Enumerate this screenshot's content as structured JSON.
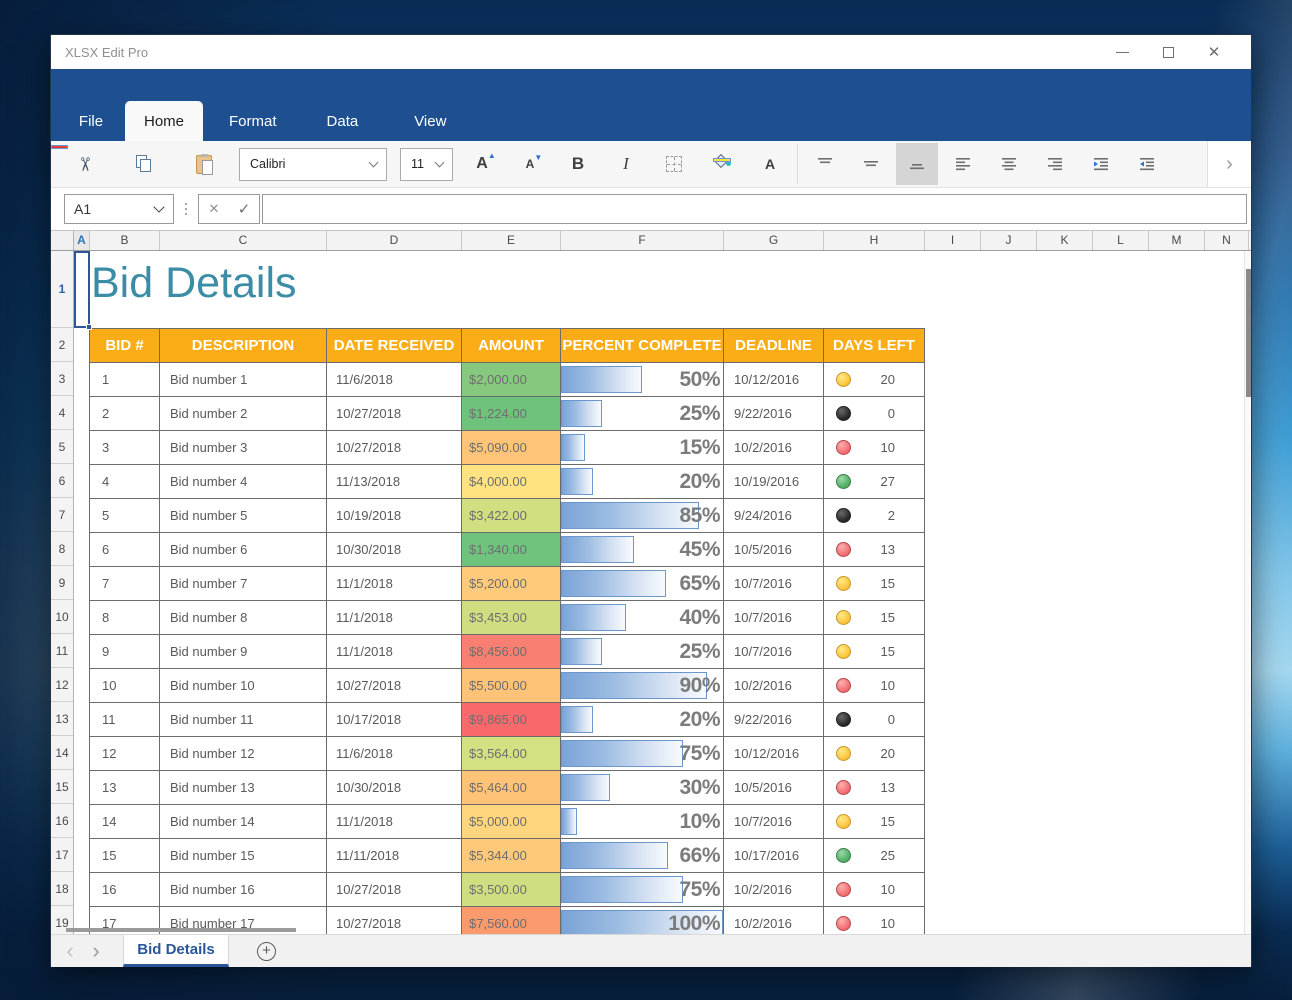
{
  "window": {
    "title": "XLSX Edit Pro"
  },
  "ribbon": {
    "tabs": [
      "File",
      "Home",
      "Format",
      "Data",
      "View"
    ],
    "active_tab": "Home"
  },
  "toolbar": {
    "font_name": "Calibri",
    "font_size": "11",
    "bold_glyph": "B",
    "italic_glyph": "I",
    "grow_font_glyph": "A",
    "shrink_font_glyph": "A",
    "font_color_glyph": "A"
  },
  "glyphs": {
    "cut": "✂",
    "cancel": "✕",
    "check": "✓",
    "chevron_left": "‹",
    "chevron_right": "›",
    "overflow_chevron": "›",
    "add_sheet": "+",
    "close_window": "✕"
  },
  "formula_bar": {
    "cell_reference": "A1",
    "formula_value": ""
  },
  "grid": {
    "column_headers": [
      "A",
      "B",
      "C",
      "D",
      "E",
      "F",
      "G",
      "H",
      "I",
      "J",
      "K",
      "L",
      "M",
      "N"
    ],
    "row_headers": [
      "1",
      "2",
      "3",
      "4",
      "5",
      "6",
      "7",
      "8",
      "9",
      "10",
      "11",
      "12",
      "13",
      "14",
      "15",
      "16",
      "17",
      "18",
      "19"
    ],
    "selected_cell": "A1",
    "selected_column": "A",
    "selected_row": "1",
    "sheet_title": "Bid Details"
  },
  "table": {
    "headers": [
      "BID #",
      "DESCRIPTION",
      "DATE RECEIVED",
      "AMOUNT",
      "PERCENT COMPLETE",
      "DEADLINE",
      "DAYS LEFT"
    ],
    "rows": [
      {
        "bid": "1",
        "description": "Bid number 1",
        "date_received": "11/6/2018",
        "amount": "$2,000.00",
        "amount_color": "#86C87E",
        "percent_value": 50,
        "percent_label": "50%",
        "deadline": "10/12/2016",
        "status_light": "yellow",
        "days_left": "20"
      },
      {
        "bid": "2",
        "description": "Bid number 2",
        "date_received": "10/27/2018",
        "amount": "$1,224.00",
        "amount_color": "#6EC27C",
        "percent_value": 25,
        "percent_label": "25%",
        "deadline": "9/22/2016",
        "status_light": "black",
        "days_left": "0"
      },
      {
        "bid": "3",
        "description": "Bid number 3",
        "date_received": "10/27/2018",
        "amount": "$5,090.00",
        "amount_color": "#FFC478",
        "percent_value": 15,
        "percent_label": "15%",
        "deadline": "10/2/2016",
        "status_light": "red",
        "days_left": "10"
      },
      {
        "bid": "4",
        "description": "Bid number 4",
        "date_received": "11/13/2018",
        "amount": "$4,000.00",
        "amount_color": "#FFE383",
        "percent_value": 20,
        "percent_label": "20%",
        "deadline": "10/19/2016",
        "status_light": "green",
        "days_left": "27"
      },
      {
        "bid": "5",
        "description": "Bid number 5",
        "date_received": "10/19/2018",
        "amount": "$3,422.00",
        "amount_color": "#D2DF81",
        "percent_value": 85,
        "percent_label": "85%",
        "deadline": "9/24/2016",
        "status_light": "black",
        "days_left": "2"
      },
      {
        "bid": "6",
        "description": "Bid number 6",
        "date_received": "10/30/2018",
        "amount": "$1,340.00",
        "amount_color": "#70C37C",
        "percent_value": 45,
        "percent_label": "45%",
        "deadline": "10/5/2016",
        "status_light": "red",
        "days_left": "13"
      },
      {
        "bid": "7",
        "description": "Bid number 7",
        "date_received": "11/1/2018",
        "amount": "$5,200.00",
        "amount_color": "#FFCA7A",
        "percent_value": 65,
        "percent_label": "65%",
        "deadline": "10/7/2016",
        "status_light": "yellow",
        "days_left": "15"
      },
      {
        "bid": "8",
        "description": "Bid number 8",
        "date_received": "11/1/2018",
        "amount": "$3,453.00",
        "amount_color": "#D0DE81",
        "percent_value": 40,
        "percent_label": "40%",
        "deadline": "10/7/2016",
        "status_light": "yellow",
        "days_left": "15"
      },
      {
        "bid": "9",
        "description": "Bid number 9",
        "date_received": "11/1/2018",
        "amount": "$8,456.00",
        "amount_color": "#F87F72",
        "percent_value": 25,
        "percent_label": "25%",
        "deadline": "10/7/2016",
        "status_light": "yellow",
        "days_left": "15"
      },
      {
        "bid": "10",
        "description": "Bid number 10",
        "date_received": "10/27/2018",
        "amount": "$5,500.00",
        "amount_color": "#FFC377",
        "percent_value": 90,
        "percent_label": "90%",
        "deadline": "10/2/2016",
        "status_light": "red",
        "days_left": "10"
      },
      {
        "bid": "11",
        "description": "Bid number 11",
        "date_received": "10/17/2018",
        "amount": "$9,865.00",
        "amount_color": "#F8696B",
        "percent_value": 20,
        "percent_label": "20%",
        "deadline": "9/22/2016",
        "status_light": "black",
        "days_left": "0"
      },
      {
        "bid": "12",
        "description": "Bid number 12",
        "date_received": "11/6/2018",
        "amount": "$3,564.00",
        "amount_color": "#D4E081",
        "percent_value": 75,
        "percent_label": "75%",
        "deadline": "10/12/2016",
        "status_light": "yellow",
        "days_left": "20"
      },
      {
        "bid": "13",
        "description": "Bid number 13",
        "date_received": "10/30/2018",
        "amount": "$5,464.00",
        "amount_color": "#FFC377",
        "percent_value": 30,
        "percent_label": "30%",
        "deadline": "10/5/2016",
        "status_light": "red",
        "days_left": "13"
      },
      {
        "bid": "14",
        "description": "Bid number 14",
        "date_received": "11/1/2018",
        "amount": "$5,000.00",
        "amount_color": "#FFD67E",
        "percent_value": 10,
        "percent_label": "10%",
        "deadline": "10/7/2016",
        "status_light": "yellow",
        "days_left": "15"
      },
      {
        "bid": "15",
        "description": "Bid number 15",
        "date_received": "11/11/2018",
        "amount": "$5,344.00",
        "amount_color": "#FFC97A",
        "percent_value": 66,
        "percent_label": "66%",
        "deadline": "10/17/2016",
        "status_light": "green",
        "days_left": "25"
      },
      {
        "bid": "16",
        "description": "Bid number 16",
        "date_received": "10/27/2018",
        "amount": "$3,500.00",
        "amount_color": "#CFDE81",
        "percent_value": 75,
        "percent_label": "75%",
        "deadline": "10/2/2016",
        "status_light": "red",
        "days_left": "10"
      },
      {
        "bid": "17",
        "description": "Bid number 17",
        "date_received": "10/27/2018",
        "amount": "$7,560.00",
        "amount_color": "#FB9A6C",
        "percent_value": 100,
        "percent_label": "100%",
        "deadline": "10/2/2016",
        "status_light": "red",
        "days_left": "10"
      }
    ]
  },
  "sheet_bar": {
    "active_sheet_tab": "Bid Details"
  },
  "colors": {
    "ribbon_blue": "#1E4F91",
    "table_header_orange": "#FBAD18",
    "title_teal": "#3B8CA6",
    "selection_blue": "#2F5597",
    "databar_blue": "#6C96CE",
    "status_yellow": "#FDC843",
    "status_red": "#F3797B",
    "status_green": "#55B469",
    "status_black": "#2E2E2E"
  }
}
